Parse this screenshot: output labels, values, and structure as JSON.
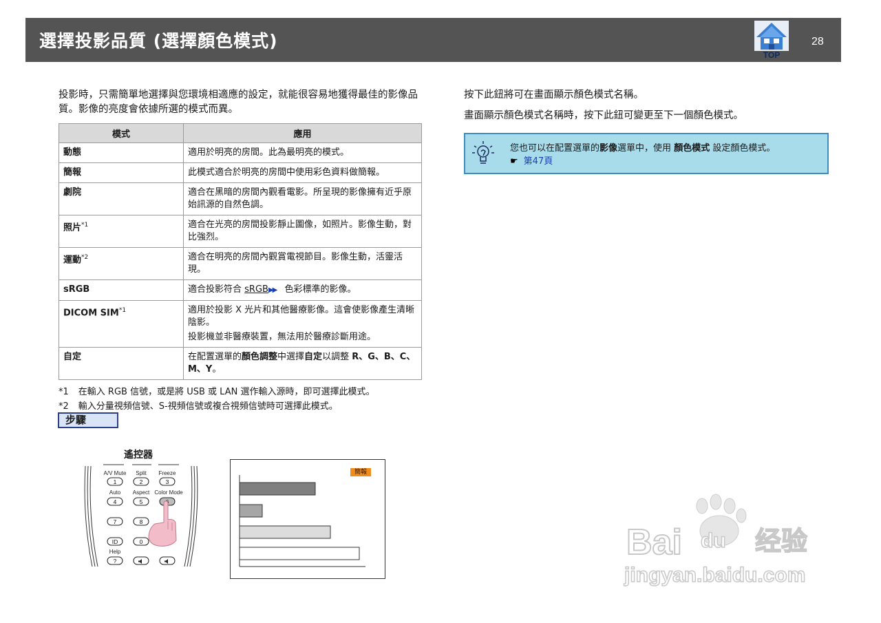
{
  "header": {
    "title": "選擇投影品質 (選擇顏色模式)",
    "top_label": "TOP",
    "page_number": "28"
  },
  "intro": "投影時，只需簡單地選擇與您環境相適應的設定，就能很容易地獲得最佳的影像品質。影像的亮度會依據所選的模式而異。",
  "table": {
    "headers": [
      "模式",
      "應用"
    ],
    "rows": [
      {
        "mode": "動態",
        "sup": "",
        "desc": "適用於明亮的房間。此為最明亮的模式。"
      },
      {
        "mode": "簡報",
        "sup": "",
        "desc": "此模式適合於明亮的房間中使用彩色資料做簡報。"
      },
      {
        "mode": "劇院",
        "sup": "",
        "desc": "適合在黑暗的房間內觀看電影。所呈現的影像擁有近乎原始訊源的自然色調。"
      },
      {
        "mode": "照片",
        "sup": "*1",
        "desc": "適合在光亮的房間投影靜止圖像，如照片。影像生動，對比強烈。"
      },
      {
        "mode": "運動",
        "sup": "*2",
        "desc": "適合在明亮的房間內觀賞電視節目。影像生動，活靈活現。"
      },
      {
        "mode": "sRGB",
        "sup": "",
        "desc_pre": "適合投影符合",
        "desc_link": "sRGB",
        "desc_post": "色彩標準的影像。"
      },
      {
        "mode": "DICOM  SIM",
        "sup": "*1",
        "desc": "適用於投影 X 光片和其他醫療影像。這會使影像產生清晰陰影。",
        "desc2": "投影機並非醫療裝置，無法用於醫療診斷用途。"
      },
      {
        "mode": "自定",
        "sup": "",
        "desc_a": "在配置選單的",
        "desc_b": "顏色調整",
        "desc_c": "中選擇",
        "desc_d": "自定",
        "desc_e": "以調整",
        "desc_rgb": "R、G、B、C、M、Y",
        "desc_end": "。"
      }
    ]
  },
  "footnotes": [
    {
      "key": "*1",
      "text": "在輸入 RGB 信號，或是將 USB 或 LAN 選作輸入源時，即可選擇此模式。"
    },
    {
      "key": "*2",
      "text": "輸入分量視頻信號、S-視頻信號或複合視頻信號時可選擇此模式。"
    }
  ],
  "steps_label": "步驟",
  "remote": {
    "title": "遙控器",
    "labels": {
      "av_mute": "A/V Mute",
      "split": "Split",
      "freeze": "Freeze",
      "auto": "Auto",
      "aspect": "Aspect",
      "color_mode": "Color Mode",
      "id": "ID",
      "help": "Help",
      "help_symbol": "?",
      "n1": "1",
      "n2": "2",
      "n3": "3",
      "n4": "4",
      "n5": "5",
      "n6": "6",
      "n7": "7",
      "n8": "8",
      "n0": "0"
    }
  },
  "screen": {
    "badge": "簡報"
  },
  "right": {
    "line1": "按下此鈕將可在畫面顯示顏色模式名稱。",
    "line2": "畫面顯示顏色模式名稱時，按下此鈕可變更至下一個顏色模式。"
  },
  "tip": {
    "pre": "您也可以在配置選單的",
    "bold1": "影像",
    "mid": "選單中，使用",
    "bold2": "顏色模式",
    "post": "設定顏色模式。",
    "hand": "☛",
    "link": "第47頁"
  },
  "watermark": {
    "brand": "Bai",
    "du": "du",
    "jingyan": "经验",
    "url": "jingyan.baidu.com"
  },
  "colors": {
    "header_bg": "#545454",
    "tip_bg": "#a9dcea",
    "tip_border": "#3b8fbf",
    "badge": "#f08c1c",
    "link_blue": "#1a3fb0"
  }
}
